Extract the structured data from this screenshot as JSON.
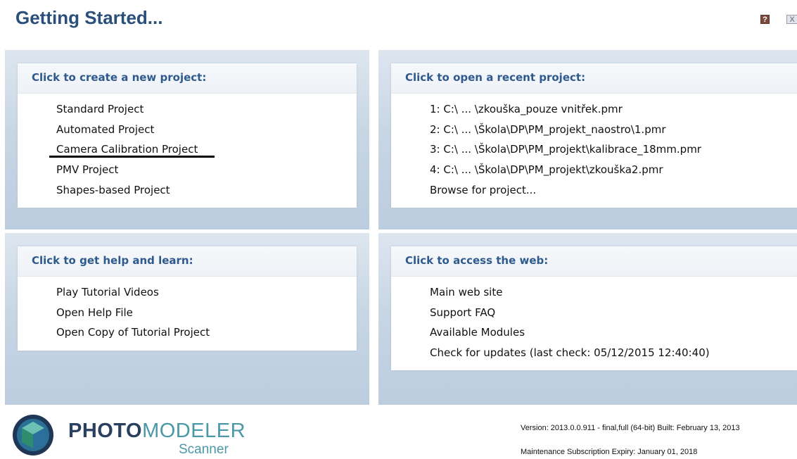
{
  "header": {
    "title": "Getting Started...",
    "help_label": "?",
    "close_label": "X"
  },
  "new_project": {
    "title": "Click to create a new project:",
    "items": [
      "Standard Project",
      "Automated Project",
      "Camera Calibration Project",
      "PMV Project",
      "Shapes-based Project"
    ]
  },
  "recent_project": {
    "title": "Click to open a recent project:",
    "items": [
      "1: C:\\ ... \\zkouška_pouze vnitřek.pmr",
      "2: C:\\ ... \\Škola\\DP\\PM_projekt_naostro\\1.pmr",
      "3: C:\\ ... \\Škola\\DP\\PM_projekt\\kalibrace_18mm.pmr",
      "4: C:\\ ... \\Škola\\DP\\PM_projekt\\zkouška2.pmr",
      "Browse for project..."
    ]
  },
  "help_learn": {
    "title": "Click to get help and learn:",
    "items": [
      "Play Tutorial Videos",
      "Open Help File",
      "Open Copy of Tutorial Project"
    ]
  },
  "web": {
    "title": "Click to access the web:",
    "items": [
      "Main web site",
      "Support FAQ",
      "Available Modules",
      "Check for updates (last check: 05/12/2015 12:40:40)"
    ]
  },
  "footer": {
    "brand_part1": "PHOTO",
    "brand_part2": "MODELER",
    "brand_sub": "Scanner",
    "version": "Version: 2013.0.0.911 - final,full (64-bit) Built: February 13, 2013",
    "maintenance": "Maintenance Subscription Expiry: January 01, 2018"
  }
}
